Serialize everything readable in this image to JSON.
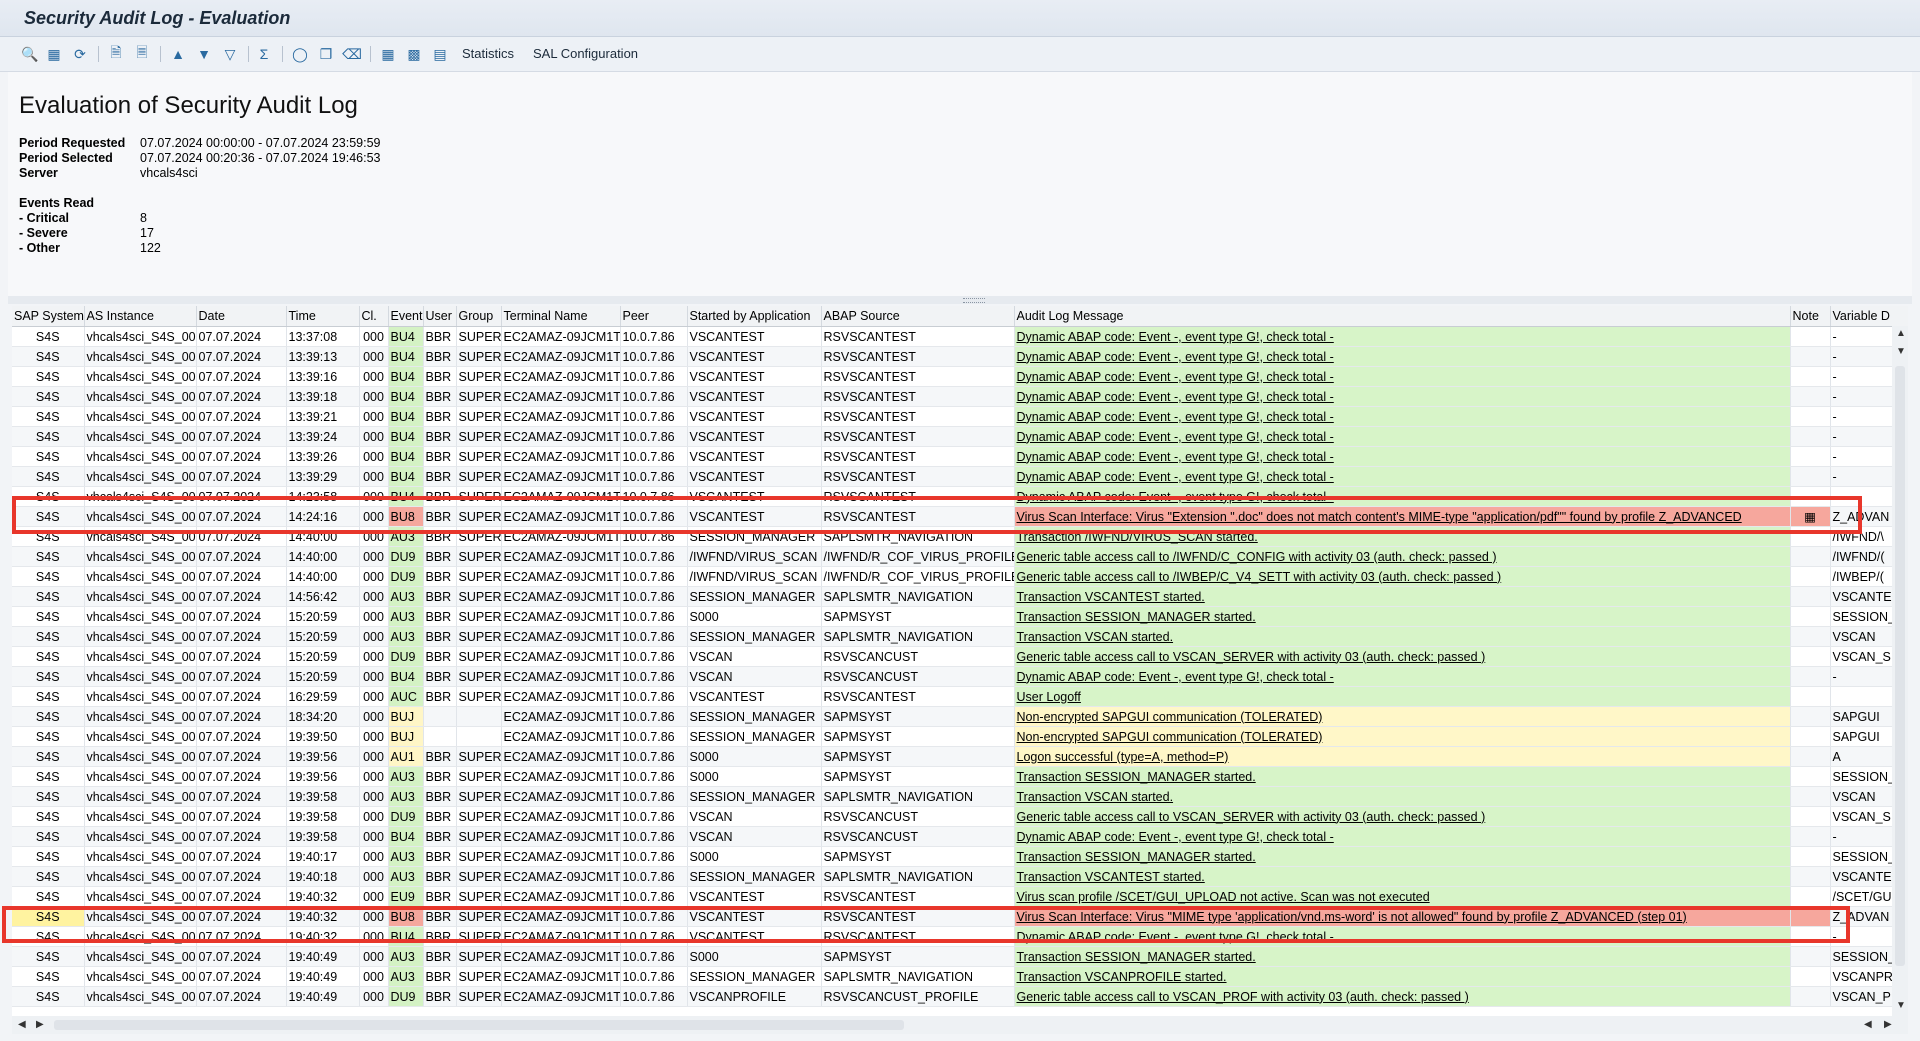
{
  "window": {
    "title": "Security Audit Log - Evaluation"
  },
  "toolbar": {
    "icons": [
      "zoom-icon",
      "layout-icon",
      "refresh-icon",
      "export-icon",
      "print-preview-icon",
      "sort-ascending-icon",
      "filter-icon",
      "filter-settings-icon",
      "sum-icon",
      "details-icon",
      "copy-icon",
      "delete-filter-icon",
      "table-icon",
      "grid-icon",
      "layout-settings-icon"
    ],
    "statistics_label": "Statistics",
    "sal_config_label": "SAL Configuration"
  },
  "header": {
    "title": "Evaluation of Security Audit Log",
    "period_requested_label": "Period Requested",
    "period_requested_value": "07.07.2024 00:00:00 - 07.07.2024 23:59:59",
    "period_selected_label": "Period Selected",
    "period_selected_value": "07.07.2024 00:20:36 - 07.07.2024 19:46:53",
    "server_label": "Server",
    "server_value": "vhcals4sci",
    "events_read_label": "Events Read",
    "critical_label": "- Critical",
    "critical_value": "8",
    "severe_label": "- Severe",
    "severe_value": "17",
    "other_label": "- Other",
    "other_value": "122"
  },
  "table": {
    "columns": [
      "SAP System",
      "AS Instance",
      "Date",
      "Time",
      "Cl.",
      "Event",
      "User",
      "Group",
      "Terminal Name",
      "Peer",
      "Started by Application",
      "ABAP Source",
      "Audit Log Message",
      "Note",
      "Variable D"
    ],
    "colors": {
      "green": "#d4f2c4",
      "red": "#f5a79d",
      "yellow": "#fff6c6",
      "highlight": "#e8362b"
    },
    "rows": [
      {
        "sys": "S4S",
        "inst": "vhcals4sci_S4S_00",
        "date": "07.07.2024",
        "time": "13:37:08",
        "cl": "000",
        "event": "BU4",
        "ev": "green",
        "user": "BBR",
        "group": "SUPER",
        "term": "EC2AMAZ-09JCM1T",
        "peer": "10.0.7.86",
        "app": "VSCANTEST",
        "src": "RSVSCANTEST",
        "msg": "Dynamic ABAP code: Event -, event type G!, check total -",
        "mc": "green",
        "note": "",
        "var": "-"
      },
      {
        "sys": "S4S",
        "inst": "vhcals4sci_S4S_00",
        "date": "07.07.2024",
        "time": "13:39:13",
        "cl": "000",
        "event": "BU4",
        "ev": "green",
        "user": "BBR",
        "group": "SUPER",
        "term": "EC2AMAZ-09JCM1T",
        "peer": "10.0.7.86",
        "app": "VSCANTEST",
        "src": "RSVSCANTEST",
        "msg": "Dynamic ABAP code: Event -, event type G!, check total -",
        "mc": "green",
        "note": "",
        "var": "-"
      },
      {
        "sys": "S4S",
        "inst": "vhcals4sci_S4S_00",
        "date": "07.07.2024",
        "time": "13:39:16",
        "cl": "000",
        "event": "BU4",
        "ev": "green",
        "user": "BBR",
        "group": "SUPER",
        "term": "EC2AMAZ-09JCM1T",
        "peer": "10.0.7.86",
        "app": "VSCANTEST",
        "src": "RSVSCANTEST",
        "msg": "Dynamic ABAP code: Event -, event type G!, check total -",
        "mc": "green",
        "note": "",
        "var": "-"
      },
      {
        "sys": "S4S",
        "inst": "vhcals4sci_S4S_00",
        "date": "07.07.2024",
        "time": "13:39:18",
        "cl": "000",
        "event": "BU4",
        "ev": "green",
        "user": "BBR",
        "group": "SUPER",
        "term": "EC2AMAZ-09JCM1T",
        "peer": "10.0.7.86",
        "app": "VSCANTEST",
        "src": "RSVSCANTEST",
        "msg": "Dynamic ABAP code: Event -, event type G!, check total -",
        "mc": "green",
        "note": "",
        "var": "-"
      },
      {
        "sys": "S4S",
        "inst": "vhcals4sci_S4S_00",
        "date": "07.07.2024",
        "time": "13:39:21",
        "cl": "000",
        "event": "BU4",
        "ev": "green",
        "user": "BBR",
        "group": "SUPER",
        "term": "EC2AMAZ-09JCM1T",
        "peer": "10.0.7.86",
        "app": "VSCANTEST",
        "src": "RSVSCANTEST",
        "msg": "Dynamic ABAP code: Event -, event type G!, check total -",
        "mc": "green",
        "note": "",
        "var": "-"
      },
      {
        "sys": "S4S",
        "inst": "vhcals4sci_S4S_00",
        "date": "07.07.2024",
        "time": "13:39:24",
        "cl": "000",
        "event": "BU4",
        "ev": "green",
        "user": "BBR",
        "group": "SUPER",
        "term": "EC2AMAZ-09JCM1T",
        "peer": "10.0.7.86",
        "app": "VSCANTEST",
        "src": "RSVSCANTEST",
        "msg": "Dynamic ABAP code: Event -, event type G!, check total -",
        "mc": "green",
        "note": "",
        "var": "-"
      },
      {
        "sys": "S4S",
        "inst": "vhcals4sci_S4S_00",
        "date": "07.07.2024",
        "time": "13:39:26",
        "cl": "000",
        "event": "BU4",
        "ev": "green",
        "user": "BBR",
        "group": "SUPER",
        "term": "EC2AMAZ-09JCM1T",
        "peer": "10.0.7.86",
        "app": "VSCANTEST",
        "src": "RSVSCANTEST",
        "msg": "Dynamic ABAP code: Event -, event type G!, check total -",
        "mc": "green",
        "note": "",
        "var": "-"
      },
      {
        "sys": "S4S",
        "inst": "vhcals4sci_S4S_00",
        "date": "07.07.2024",
        "time": "13:39:29",
        "cl": "000",
        "event": "BU4",
        "ev": "green",
        "user": "BBR",
        "group": "SUPER",
        "term": "EC2AMAZ-09JCM1T",
        "peer": "10.0.7.86",
        "app": "VSCANTEST",
        "src": "RSVSCANTEST",
        "msg": "Dynamic ABAP code: Event -, event type G!, check total -",
        "mc": "green",
        "note": "",
        "var": "-"
      },
      {
        "sys": "S4S",
        "inst": "vhcals4sci_S4S_00",
        "date": "07.07.2024",
        "time": "14:23:58",
        "cl": "000",
        "event": "BU4",
        "ev": "green",
        "user": "BBR",
        "group": "SUPER",
        "term": "EC2AMAZ-09JCM1T",
        "peer": "10.0.7.86",
        "app": "VSCANTEST",
        "src": "RSVSCANTEST",
        "msg": "Dynamic ABAP code: Event -, event type G!, check total -",
        "mc": "green",
        "note": "",
        "var": "-"
      },
      {
        "sys": "S4S",
        "inst": "vhcals4sci_S4S_00",
        "date": "07.07.2024",
        "time": "14:24:16",
        "cl": "000",
        "event": "BU8",
        "ev": "red",
        "user": "BBR",
        "group": "SUPER",
        "term": "EC2AMAZ-09JCM1T",
        "peer": "10.0.7.86",
        "app": "VSCANTEST",
        "src": "RSVSCANTEST",
        "msg": "Virus Scan Interface: Virus \"Extension \".doc\" does not match content's MIME-type \"application/pdf\"\" found by profile Z_ADVANCED",
        "mc": "red",
        "note": "▦",
        "var": "Z_ADVAN"
      },
      {
        "sys": "S4S",
        "inst": "vhcals4sci_S4S_00",
        "date": "07.07.2024",
        "time": "14:40:00",
        "cl": "000",
        "event": "AU3",
        "ev": "green",
        "user": "BBR",
        "group": "SUPER",
        "term": "EC2AMAZ-09JCM1T",
        "peer": "10.0.7.86",
        "app": "SESSION_MANAGER",
        "src": "SAPLSMTR_NAVIGATION",
        "msg": "Transaction /IWFND/VIRUS_SCAN started.",
        "mc": "green",
        "note": "",
        "var": "/IWFND/\\"
      },
      {
        "sys": "S4S",
        "inst": "vhcals4sci_S4S_00",
        "date": "07.07.2024",
        "time": "14:40:00",
        "cl": "000",
        "event": "DU9",
        "ev": "green",
        "user": "BBR",
        "group": "SUPER",
        "term": "EC2AMAZ-09JCM1T",
        "peer": "10.0.7.86",
        "app": "/IWFND/VIRUS_SCAN",
        "src": "/IWFND/R_COF_VIRUS_PROFILE",
        "msg": "Generic table access call to /IWFND/C_CONFIG with activity 03 (auth. check: passed )",
        "mc": "green",
        "note": "",
        "var": "/IWFND/("
      },
      {
        "sys": "S4S",
        "inst": "vhcals4sci_S4S_00",
        "date": "07.07.2024",
        "time": "14:40:00",
        "cl": "000",
        "event": "DU9",
        "ev": "green",
        "user": "BBR",
        "group": "SUPER",
        "term": "EC2AMAZ-09JCM1T",
        "peer": "10.0.7.86",
        "app": "/IWFND/VIRUS_SCAN",
        "src": "/IWFND/R_COF_VIRUS_PROFILE",
        "msg": "Generic table access call to /IWBEP/C_V4_SETT with activity 03 (auth. check: passed )",
        "mc": "green",
        "note": "",
        "var": "/IWBEP/("
      },
      {
        "sys": "S4S",
        "inst": "vhcals4sci_S4S_00",
        "date": "07.07.2024",
        "time": "14:56:42",
        "cl": "000",
        "event": "AU3",
        "ev": "green",
        "user": "BBR",
        "group": "SUPER",
        "term": "EC2AMAZ-09JCM1T",
        "peer": "10.0.7.86",
        "app": "SESSION_MANAGER",
        "src": "SAPLSMTR_NAVIGATION",
        "msg": "Transaction VSCANTEST started.",
        "mc": "green",
        "note": "",
        "var": "VSCANTE"
      },
      {
        "sys": "S4S",
        "inst": "vhcals4sci_S4S_00",
        "date": "07.07.2024",
        "time": "15:20:59",
        "cl": "000",
        "event": "AU3",
        "ev": "green",
        "user": "BBR",
        "group": "SUPER",
        "term": "EC2AMAZ-09JCM1T",
        "peer": "10.0.7.86",
        "app": "S000",
        "src": "SAPMSYST",
        "msg": "Transaction SESSION_MANAGER started.",
        "mc": "green",
        "note": "",
        "var": "SESSION_"
      },
      {
        "sys": "S4S",
        "inst": "vhcals4sci_S4S_00",
        "date": "07.07.2024",
        "time": "15:20:59",
        "cl": "000",
        "event": "AU3",
        "ev": "green",
        "user": "BBR",
        "group": "SUPER",
        "term": "EC2AMAZ-09JCM1T",
        "peer": "10.0.7.86",
        "app": "SESSION_MANAGER",
        "src": "SAPLSMTR_NAVIGATION",
        "msg": "Transaction VSCAN started.",
        "mc": "green",
        "note": "",
        "var": "VSCAN"
      },
      {
        "sys": "S4S",
        "inst": "vhcals4sci_S4S_00",
        "date": "07.07.2024",
        "time": "15:20:59",
        "cl": "000",
        "event": "DU9",
        "ev": "green",
        "user": "BBR",
        "group": "SUPER",
        "term": "EC2AMAZ-09JCM1T",
        "peer": "10.0.7.86",
        "app": "VSCAN",
        "src": "RSVSCANCUST",
        "msg": "Generic table access call to VSCAN_SERVER with activity 03 (auth. check: passed )",
        "mc": "green",
        "note": "",
        "var": "VSCAN_S"
      },
      {
        "sys": "S4S",
        "inst": "vhcals4sci_S4S_00",
        "date": "07.07.2024",
        "time": "15:20:59",
        "cl": "000",
        "event": "BU4",
        "ev": "green",
        "user": "BBR",
        "group": "SUPER",
        "term": "EC2AMAZ-09JCM1T",
        "peer": "10.0.7.86",
        "app": "VSCAN",
        "src": "RSVSCANCUST",
        "msg": "Dynamic ABAP code: Event -, event type G!, check total -",
        "mc": "green",
        "note": "",
        "var": "-"
      },
      {
        "sys": "S4S",
        "inst": "vhcals4sci_S4S_00",
        "date": "07.07.2024",
        "time": "16:29:59",
        "cl": "000",
        "event": "AUC",
        "ev": "green",
        "user": "BBR",
        "group": "SUPER",
        "term": "EC2AMAZ-09JCM1T",
        "peer": "10.0.7.86",
        "app": "VSCANTEST",
        "src": "RSVSCANTEST",
        "msg": "User Logoff",
        "mc": "green",
        "note": "",
        "var": ""
      },
      {
        "sys": "S4S",
        "inst": "vhcals4sci_S4S_00",
        "date": "07.07.2024",
        "time": "18:34:20",
        "cl": "000",
        "event": "BUJ",
        "ev": "yellow",
        "user": "",
        "group": "",
        "term": "EC2AMAZ-09JCM1T",
        "peer": "10.0.7.86",
        "app": "SESSION_MANAGER",
        "src": "SAPMSYST",
        "msg": "Non-encrypted SAPGUI communication (TOLERATED)",
        "mc": "yellow",
        "note": "",
        "var": "SAPGUI"
      },
      {
        "sys": "S4S",
        "inst": "vhcals4sci_S4S_00",
        "date": "07.07.2024",
        "time": "19:39:50",
        "cl": "000",
        "event": "BUJ",
        "ev": "yellow",
        "user": "",
        "group": "",
        "term": "EC2AMAZ-09JCM1T",
        "peer": "10.0.7.86",
        "app": "SESSION_MANAGER",
        "src": "SAPMSYST",
        "msg": "Non-encrypted SAPGUI communication (TOLERATED)",
        "mc": "yellow",
        "note": "",
        "var": "SAPGUI"
      },
      {
        "sys": "S4S",
        "inst": "vhcals4sci_S4S_00",
        "date": "07.07.2024",
        "time": "19:39:56",
        "cl": "000",
        "event": "AU1",
        "ev": "yellow",
        "user": "BBR",
        "group": "SUPER",
        "term": "EC2AMAZ-09JCM1T",
        "peer": "10.0.7.86",
        "app": "S000",
        "src": "SAPMSYST",
        "msg": "Logon successful (type=A, method=P)",
        "mc": "yellow",
        "note": "",
        "var": "A"
      },
      {
        "sys": "S4S",
        "inst": "vhcals4sci_S4S_00",
        "date": "07.07.2024",
        "time": "19:39:56",
        "cl": "000",
        "event": "AU3",
        "ev": "green",
        "user": "BBR",
        "group": "SUPER",
        "term": "EC2AMAZ-09JCM1T",
        "peer": "10.0.7.86",
        "app": "S000",
        "src": "SAPMSYST",
        "msg": "Transaction SESSION_MANAGER started.",
        "mc": "green",
        "note": "",
        "var": "SESSION_"
      },
      {
        "sys": "S4S",
        "inst": "vhcals4sci_S4S_00",
        "date": "07.07.2024",
        "time": "19:39:58",
        "cl": "000",
        "event": "AU3",
        "ev": "green",
        "user": "BBR",
        "group": "SUPER",
        "term": "EC2AMAZ-09JCM1T",
        "peer": "10.0.7.86",
        "app": "SESSION_MANAGER",
        "src": "SAPLSMTR_NAVIGATION",
        "msg": "Transaction VSCAN started.",
        "mc": "green",
        "note": "",
        "var": "VSCAN"
      },
      {
        "sys": "S4S",
        "inst": "vhcals4sci_S4S_00",
        "date": "07.07.2024",
        "time": "19:39:58",
        "cl": "000",
        "event": "DU9",
        "ev": "green",
        "user": "BBR",
        "group": "SUPER",
        "term": "EC2AMAZ-09JCM1T",
        "peer": "10.0.7.86",
        "app": "VSCAN",
        "src": "RSVSCANCUST",
        "msg": "Generic table access call to VSCAN_SERVER with activity 03 (auth. check: passed )",
        "mc": "green",
        "note": "",
        "var": "VSCAN_S"
      },
      {
        "sys": "S4S",
        "inst": "vhcals4sci_S4S_00",
        "date": "07.07.2024",
        "time": "19:39:58",
        "cl": "000",
        "event": "BU4",
        "ev": "green",
        "user": "BBR",
        "group": "SUPER",
        "term": "EC2AMAZ-09JCM1T",
        "peer": "10.0.7.86",
        "app": "VSCAN",
        "src": "RSVSCANCUST",
        "msg": "Dynamic ABAP code: Event -, event type G!, check total -",
        "mc": "green",
        "note": "",
        "var": "-"
      },
      {
        "sys": "S4S",
        "inst": "vhcals4sci_S4S_00",
        "date": "07.07.2024",
        "time": "19:40:17",
        "cl": "000",
        "event": "AU3",
        "ev": "green",
        "user": "BBR",
        "group": "SUPER",
        "term": "EC2AMAZ-09JCM1T",
        "peer": "10.0.7.86",
        "app": "S000",
        "src": "SAPMSYST",
        "msg": "Transaction SESSION_MANAGER started.",
        "mc": "green",
        "note": "",
        "var": "SESSION_"
      },
      {
        "sys": "S4S",
        "inst": "vhcals4sci_S4S_00",
        "date": "07.07.2024",
        "time": "19:40:18",
        "cl": "000",
        "event": "AU3",
        "ev": "green",
        "user": "BBR",
        "group": "SUPER",
        "term": "EC2AMAZ-09JCM1T",
        "peer": "10.0.7.86",
        "app": "SESSION_MANAGER",
        "src": "SAPLSMTR_NAVIGATION",
        "msg": "Transaction VSCANTEST started.",
        "mc": "green",
        "note": "",
        "var": "VSCANTE"
      },
      {
        "sys": "S4S",
        "inst": "vhcals4sci_S4S_00",
        "date": "07.07.2024",
        "time": "19:40:32",
        "cl": "000",
        "event": "EU9",
        "ev": "green",
        "user": "BBR",
        "group": "SUPER",
        "term": "EC2AMAZ-09JCM1T",
        "peer": "10.0.7.86",
        "app": "VSCANTEST",
        "src": "RSVSCANTEST",
        "msg": "Virus scan profile /SCET/GUI_UPLOAD not active. Scan was not executed",
        "mc": "green",
        "note": "",
        "var": "/SCET/GU"
      },
      {
        "sys": "S4S",
        "inst": "vhcals4sci_S4S_00",
        "date": "07.07.2024",
        "time": "19:40:32",
        "cl": "000",
        "event": "BU8",
        "ev": "red",
        "user": "BBR",
        "group": "SUPER",
        "term": "EC2AMAZ-09JCM1T",
        "peer": "10.0.7.86",
        "app": "VSCANTEST",
        "src": "RSVSCANTEST",
        "msg": "Virus Scan Interface: Virus \"MIME type 'application/vnd.ms-word' is not allowed\" found by profile Z_ADVANCED (step 01)",
        "mc": "red",
        "note": "",
        "var": "Z_ADVAN",
        "sel": true
      },
      {
        "sys": "S4S",
        "inst": "vhcals4sci_S4S_00",
        "date": "07.07.2024",
        "time": "19:40:32",
        "cl": "000",
        "event": "BU4",
        "ev": "green",
        "user": "BBR",
        "group": "SUPER",
        "term": "EC2AMAZ-09JCM1T",
        "peer": "10.0.7.86",
        "app": "VSCANTEST",
        "src": "RSVSCANTEST",
        "msg": "Dynamic ABAP code: Event -, event type G!, check total -",
        "mc": "green",
        "note": "",
        "var": "-"
      },
      {
        "sys": "S4S",
        "inst": "vhcals4sci_S4S_00",
        "date": "07.07.2024",
        "time": "19:40:49",
        "cl": "000",
        "event": "AU3",
        "ev": "green",
        "user": "BBR",
        "group": "SUPER",
        "term": "EC2AMAZ-09JCM1T",
        "peer": "10.0.7.86",
        "app": "S000",
        "src": "SAPMSYST",
        "msg": "Transaction SESSION_MANAGER started.",
        "mc": "green",
        "note": "",
        "var": "SESSION_"
      },
      {
        "sys": "S4S",
        "inst": "vhcals4sci_S4S_00",
        "date": "07.07.2024",
        "time": "19:40:49",
        "cl": "000",
        "event": "AU3",
        "ev": "green",
        "user": "BBR",
        "group": "SUPER",
        "term": "EC2AMAZ-09JCM1T",
        "peer": "10.0.7.86",
        "app": "SESSION_MANAGER",
        "src": "SAPLSMTR_NAVIGATION",
        "msg": "Transaction VSCANPROFILE started.",
        "mc": "green",
        "note": "",
        "var": "VSCANPROFI"
      },
      {
        "sys": "S4S",
        "inst": "vhcals4sci_S4S_00",
        "date": "07.07.2024",
        "time": "19:40:49",
        "cl": "000",
        "event": "DU9",
        "ev": "green",
        "user": "BBR",
        "group": "SUPER",
        "term": "EC2AMAZ-09JCM1T",
        "peer": "10.0.7.86",
        "app": "VSCANPROFILE",
        "src": "RSVSCANCUST_PROFILE",
        "msg": "Generic table access call to VSCAN_PROF with activity 03 (auth. check: passed )",
        "mc": "green",
        "note": "",
        "var": "VSCAN_P"
      }
    ]
  }
}
